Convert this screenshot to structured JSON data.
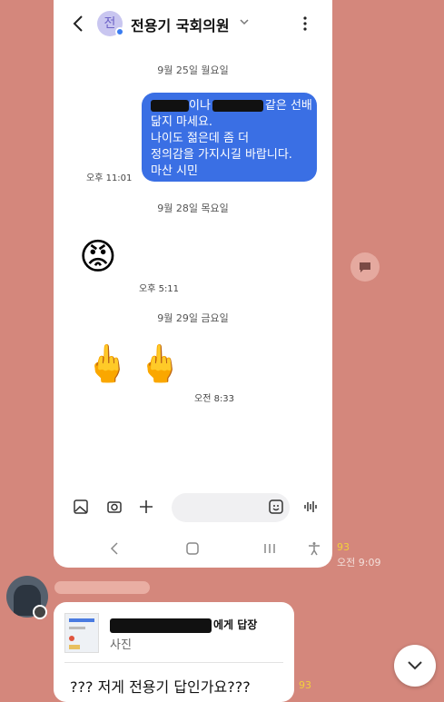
{
  "header": {
    "avatar_initial": "전",
    "contact_name": "전용기 국회의원"
  },
  "dates": {
    "d1": "9월 25일 월요일",
    "d2": "9월 28일 목요일",
    "d3": "9월 29일 금요일"
  },
  "message_out": {
    "line1_mid": "이나",
    "line1_end": "같은 선배",
    "line2": "닮지 마세요.",
    "line3": "나이도 젊은데 좀 더",
    "line4": "정의감을 가지시길 바랍니다.",
    "line5": "마산 시민",
    "time": "오후 11:01"
  },
  "emoji1": {
    "glyph": "😡",
    "time": "오후 5:11"
  },
  "emoji2": {
    "glyph1": "🖕",
    "glyph2": "🖕",
    "time": "오전 8:33"
  },
  "outer": {
    "count1": "93",
    "time1": "오전 9:09",
    "reply_to_suffix": "에게 답장",
    "reply_sub": "사진",
    "reply_message": "??? 저게 전용기 답인가요???",
    "count2": "93"
  },
  "colors": {
    "background": "#d4877c",
    "bubble": "#3a6fe4",
    "unread": "#f2d03b"
  }
}
